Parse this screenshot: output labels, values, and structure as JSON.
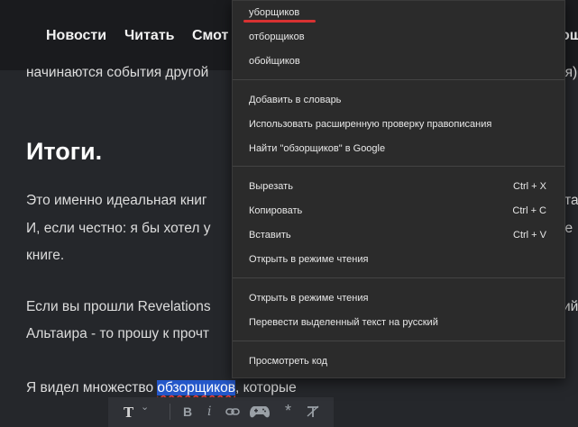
{
  "nav": {
    "items": [
      "Новости",
      "Читать",
      "Смот",
      "ощ"
    ]
  },
  "article": {
    "line_top": [
      "начинаются события другой",
      "ия)"
    ],
    "heading": "Итоги.",
    "para1": [
      "Это именно идеальная книг",
      "ета"
    ],
    "para2": [
      "И, если честно: я бы хотел у",
      "не"
    ],
    "para3": "книге.",
    "para4": [
      "Если вы прошли Revelations",
      "ий"
    ],
    "para5": "Альтаира - то прошу к прочт",
    "para6_before": "Я видел множество ",
    "para6_selected": "обзорщиков",
    "para6_after": ", которые"
  },
  "toolbar": {
    "text_style": "T",
    "bold": "B",
    "italic": "i",
    "link_icon": "link-icon",
    "game_icon": "gamepad-icon",
    "spoiler": "*",
    "clear_format": "clear-format-icon"
  },
  "context_menu": {
    "suggestions": [
      "уборщиков",
      "отборщиков",
      "обойщиков"
    ],
    "dictionary": [
      "Добавить в словарь",
      "Использовать расширенную проверку правописания",
      "Найти \"обзорщиков\" в Google"
    ],
    "edit": [
      {
        "label": "Вырезать",
        "shortcut": "Ctrl + X"
      },
      {
        "label": "Копировать",
        "shortcut": "Ctrl + C"
      },
      {
        "label": "Вставить",
        "shortcut": "Ctrl + V"
      },
      {
        "label": "Открыть в режиме чтения",
        "shortcut": ""
      }
    ],
    "reading": [
      "Открыть в режиме чтения",
      "Перевести выделенный текст на русский"
    ],
    "inspect": "Просмотреть код"
  }
}
